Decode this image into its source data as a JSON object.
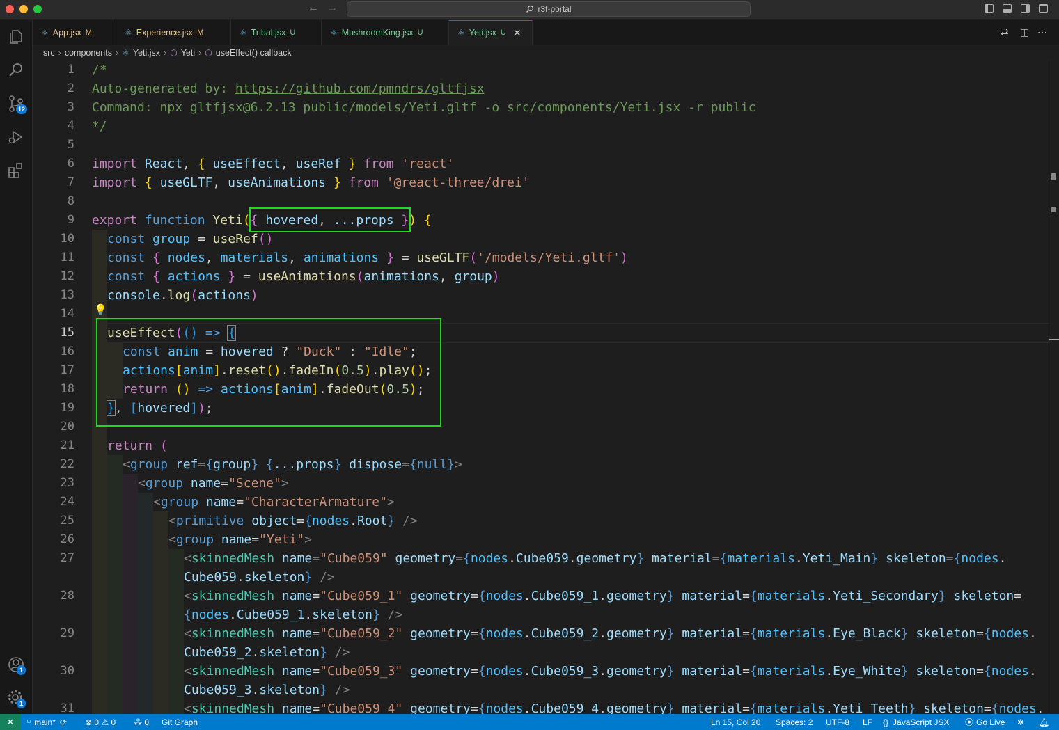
{
  "window": {
    "title": "r3f-portal"
  },
  "tabs": [
    {
      "label": "App.jsx",
      "status": "M",
      "active": false
    },
    {
      "label": "Experience.jsx",
      "status": "M",
      "active": false
    },
    {
      "label": "Tribal.jsx",
      "status": "U",
      "active": false
    },
    {
      "label": "MushroomKing.jsx",
      "status": "U",
      "active": false
    },
    {
      "label": "Yeti.jsx",
      "status": "U",
      "active": true
    }
  ],
  "breadcrumb": [
    "src",
    "components",
    "Yeti.jsx",
    "Yeti",
    "useEffect() callback"
  ],
  "activity": {
    "source_control_badge": "12",
    "accounts_badge": "1",
    "settings_badge": "1"
  },
  "line_numbers": [
    "1",
    "2",
    "3",
    "4",
    "5",
    "6",
    "7",
    "8",
    "9",
    "10",
    "11",
    "12",
    "13",
    "14",
    "15",
    "16",
    "17",
    "18",
    "19",
    "20",
    "21",
    "22",
    "23",
    "24",
    "25",
    "26",
    "27",
    "",
    "28",
    "",
    "29",
    "",
    "30",
    "",
    "31"
  ],
  "current_line": "15",
  "code": {
    "l1": "/*",
    "l2a": "Auto-generated by: ",
    "l2b": "https://github.com/pmndrs/gltfjsx",
    "l3": "Command: npx gltfjsx@6.2.13 public/models/Yeti.gltf -o src/components/Yeti.jsx -r public",
    "l4": "*/",
    "l6": [
      "import",
      "React",
      "useEffect",
      "useRef",
      "from",
      "'react'"
    ],
    "l7": [
      "import",
      "useGLTF",
      "useAnimations",
      "from",
      "'@react-three/drei'"
    ],
    "l9": [
      "export",
      "function",
      "Yeti",
      "hovered",
      "...props"
    ],
    "l10": [
      "const",
      "group",
      "useRef"
    ],
    "l11": [
      "const",
      "nodes",
      "materials",
      "animations",
      "useGLTF",
      "'/models/Yeti.gltf'"
    ],
    "l12": [
      "const",
      "actions",
      "useAnimations",
      "animations",
      "group"
    ],
    "l13": [
      "console",
      "log",
      "actions"
    ],
    "l15": [
      "useEffect",
      "=>"
    ],
    "l16": [
      "const",
      "anim",
      "hovered",
      "\"Duck\"",
      "\"Idle\""
    ],
    "l17": [
      "actions",
      "anim",
      "reset",
      "fadeIn",
      "0.5",
      "play"
    ],
    "l18": [
      "return",
      "=>",
      "actions",
      "anim",
      "fadeOut",
      "0.5"
    ],
    "l19": [
      "hovered"
    ],
    "l21": [
      "return"
    ],
    "l22": [
      "group",
      "ref",
      "group",
      "...props",
      "dispose",
      "null"
    ],
    "l23": [
      "group",
      "name",
      "\"Scene\""
    ],
    "l24": [
      "group",
      "name",
      "\"CharacterArmature\""
    ],
    "l25": [
      "primitive",
      "object",
      "nodes",
      "Root"
    ],
    "l26": [
      "group",
      "name",
      "\"Yeti\""
    ],
    "l27a": [
      "skinnedMesh",
      "name",
      "\"Cube059\"",
      "geometry",
      "nodes",
      "Cube059",
      "geometry",
      "material",
      "materials",
      "Yeti_Main",
      "skeleton",
      "nodes"
    ],
    "l27b": [
      "Cube059",
      "skeleton"
    ],
    "l28a": [
      "skinnedMesh",
      "name",
      "\"Cube059_1\"",
      "geometry",
      "nodes",
      "Cube059_1",
      "geometry",
      "material",
      "materials",
      "Yeti_Secondary",
      "skeleton"
    ],
    "l28b": [
      "nodes",
      "Cube059_1",
      "skeleton"
    ],
    "l29a": [
      "skinnedMesh",
      "name",
      "\"Cube059_2\"",
      "geometry",
      "nodes",
      "Cube059_2",
      "geometry",
      "material",
      "materials",
      "Eye_Black",
      "skeleton",
      "nodes"
    ],
    "l29b": [
      "Cube059_2",
      "skeleton"
    ],
    "l30a": [
      "skinnedMesh",
      "name",
      "\"Cube059_3\"",
      "geometry",
      "nodes",
      "Cube059_3",
      "geometry",
      "material",
      "materials",
      "Eye_White",
      "skeleton",
      "nodes"
    ],
    "l30b": [
      "Cube059_3",
      "skeleton"
    ],
    "l31a": [
      "skinnedMesh",
      "name",
      "\"Cube059_4\"",
      "geometry",
      "nodes",
      "Cube059_4",
      "geometry",
      "material",
      "materials",
      "Yeti_Teeth",
      "skeleton",
      "nodes"
    ]
  },
  "status": {
    "branch": "main*",
    "errors": "0",
    "warnings": "0",
    "ports": "0",
    "git_graph": "Git Graph",
    "position": "Ln 15, Col 20",
    "spaces": "Spaces: 2",
    "encoding": "UTF-8",
    "eol": "LF",
    "language": "JavaScript JSX",
    "golive": "Go Live"
  },
  "colors": {
    "accent": "#007acc",
    "highlight_box": "#1bdc1b"
  }
}
